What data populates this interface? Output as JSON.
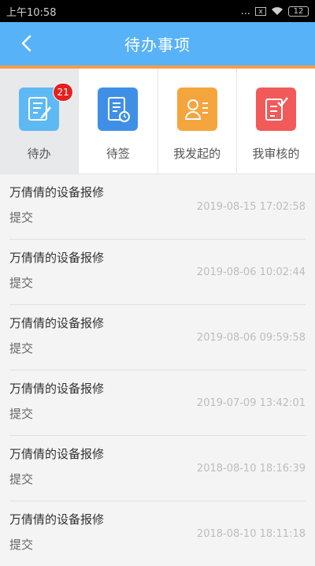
{
  "status_bar": {
    "time": "上午10:58",
    "dots": "...",
    "box": "x",
    "battery": "12"
  },
  "header": {
    "title": "待办事项"
  },
  "tabs": [
    {
      "label": "待办",
      "badge": "21",
      "color": "#5cb9f3",
      "icon": "document-edit-icon"
    },
    {
      "label": "待签",
      "color": "#3f8fe6",
      "icon": "document-clock-icon"
    },
    {
      "label": "我发起的",
      "color": "#f5a53d",
      "icon": "person-list-icon"
    },
    {
      "label": "我审核的",
      "color": "#f25a5a",
      "icon": "document-check-icon"
    }
  ],
  "items": [
    {
      "title": "万倩倩的设备报修",
      "action": "提交",
      "time": "2019-08-15 17:02:58"
    },
    {
      "title": "万倩倩的设备报修",
      "action": "提交",
      "time": "2019-08-06 10:02:44"
    },
    {
      "title": "万倩倩的设备报修",
      "action": "提交",
      "time": "2019-08-06 09:59:58"
    },
    {
      "title": "万倩倩的设备报修",
      "action": "提交",
      "time": "2019-07-09 13:42:01"
    },
    {
      "title": "万倩倩的设备报修",
      "action": "提交",
      "time": "2018-08-10 18:16:39"
    },
    {
      "title": "万倩倩的设备报修",
      "action": "提交",
      "time": "2018-08-10 18:11:18"
    }
  ]
}
